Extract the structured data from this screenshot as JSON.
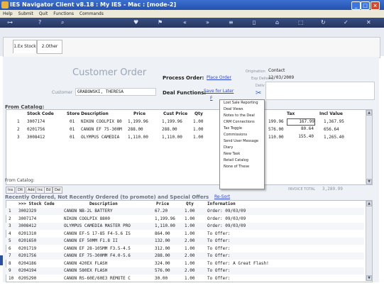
{
  "window": {
    "title": "IES Navigator Client v8.18 : My IES - Mac :     [mode-2]"
  },
  "menu": [
    "Help",
    "Submit",
    "Quit",
    "Functions",
    "Commands"
  ],
  "toolbar_icons": [
    "key-icon",
    "help-icon",
    "search-icon",
    "heart-icon",
    "flag-icon",
    "chevron-left-icon",
    "chevron-right-icon",
    "layers-icon",
    "document-icon",
    "bookmark-icon",
    "tag-icon",
    "refresh-icon",
    "check-icon",
    "close-icon"
  ],
  "tabs": [
    {
      "label": "1.Ex Stock"
    },
    {
      "label": "2.Other"
    }
  ],
  "order": {
    "heading": "Customer Order",
    "process_label": "Process Order:",
    "place_order": "Place Order",
    "customer_label": "Customer",
    "customer_value": "GRABOWSKI, THERESA",
    "deal_functions_label": "Deal Functions:",
    "save_for_later": "Save for Later",
    "deal_link_partial": "F",
    "origination_label": "Origination",
    "origination_value": "Contact",
    "exp_delivery_label": "Exp Delivery",
    "exp_delivery_value": "12/03/2009",
    "deliv_instr_label": "Deliv Instr"
  },
  "from_catalog": {
    "label": "From Catalog:",
    "columns": [
      "Stock Code",
      "Store",
      "Description",
      "Price",
      "Cust Price",
      "Qty",
      "Tax",
      "Incl Value"
    ],
    "rows": [
      {
        "n": "1",
        "code": "3007174",
        "store": "01",
        "desc": "NIKON COOLPIX 80",
        "price": "1,199.96",
        "cust": "1,199.96",
        "qty": "1.00",
        "net": "199.96",
        "tax": "167.99",
        "incl": "1,367.95"
      },
      {
        "n": "2",
        "code": "0201756",
        "store": "01",
        "desc": "CANON EF 75-300M",
        "price": "288.00",
        "cust": "288.00",
        "qty": "1.00",
        "net": "576.00",
        "tax": "80.64",
        "incl": "656.64"
      },
      {
        "n": "3",
        "code": "3008412",
        "store": "01",
        "desc": "OLYMPUS CAMEDIA",
        "price": "1,110.00",
        "cust": "1,110.00",
        "qty": "1.00",
        "net": "110.00",
        "tax": "155.40",
        "incl": "1,265.40"
      }
    ],
    "second_catalog_label": "From Catalog:",
    "buttons": [
      "Ins",
      "Dlt",
      "Add",
      "Inc",
      "Ed",
      "Del"
    ],
    "invoice_total_label": "INVOICE TOTAL",
    "invoice_total_value": "3,289.99"
  },
  "context_menu": [
    "Lost Sale Reporting",
    "Deal Views",
    "Notes to the Deal",
    "CRM Connections",
    "Tax Toggle",
    "Commissions",
    "Send User Message",
    "Diary",
    "New Task",
    "Retail Catalog",
    "None of These"
  ],
  "recent": {
    "title": "Recently Ordered, Not Recently Ordered (to promote) and Special Offers",
    "resort": "Re-Sort",
    "columns": [
      ">>> Stock Code",
      "Description",
      "Price",
      "Qty",
      "Information"
    ],
    "rows": [
      {
        "n": "1",
        "code": "3002329",
        "desc": "CANON NB-2L BATTERY",
        "price": "67.20",
        "qty": "1.00",
        "info": "Order: 09/03/09"
      },
      {
        "n": "2",
        "code": "3007174",
        "desc": "NIKON COOLPIX 8800",
        "price": "1,199.96",
        "qty": "1.00",
        "info": "Order: 09/03/09"
      },
      {
        "n": "3",
        "code": "3008412",
        "desc": "OLYMPUS CAMEDIA MASTER PRO",
        "price": "1,110.00",
        "qty": "1.00",
        "info": "Order: 09/03/09"
      },
      {
        "n": "4",
        "code": "0201310",
        "desc": "CANON EF-S 17-85 F4-5.6 IS",
        "price": "864.00",
        "qty": "1.00",
        "info": "To Offer:"
      },
      {
        "n": "5",
        "code": "0201650",
        "desc": "CANON EF 50MM F1.8 II",
        "price": "132.00",
        "qty": "2.00",
        "info": "To Offer:"
      },
      {
        "n": "6",
        "code": "0201719",
        "desc": "CANON EF 28-105MM F3.5-4.5",
        "price": "312.00",
        "qty": "1.00",
        "info": "To Offer:"
      },
      {
        "n": "7",
        "code": "0201756",
        "desc": "CANON EF 75-300MM F4.0-5.6",
        "price": "288.00",
        "qty": "2.00",
        "info": "To Offer:"
      },
      {
        "n": "8",
        "code": "0204186",
        "desc": "CANON 420EX FLASH",
        "price": "324.00",
        "qty": "1.00",
        "info": "To Offer: A Great Flash!"
      },
      {
        "n": "9",
        "code": "0204194",
        "desc": "CANON 580EX FLASH",
        "price": "576.00",
        "qty": "2.00",
        "info": "To Offer:"
      },
      {
        "n": "10",
        "code": "0205290",
        "desc": "CANON RS-60E/60E3 REMOTE C",
        "price": "30.00",
        "qty": "1.00",
        "info": "To Offer:"
      }
    ]
  }
}
